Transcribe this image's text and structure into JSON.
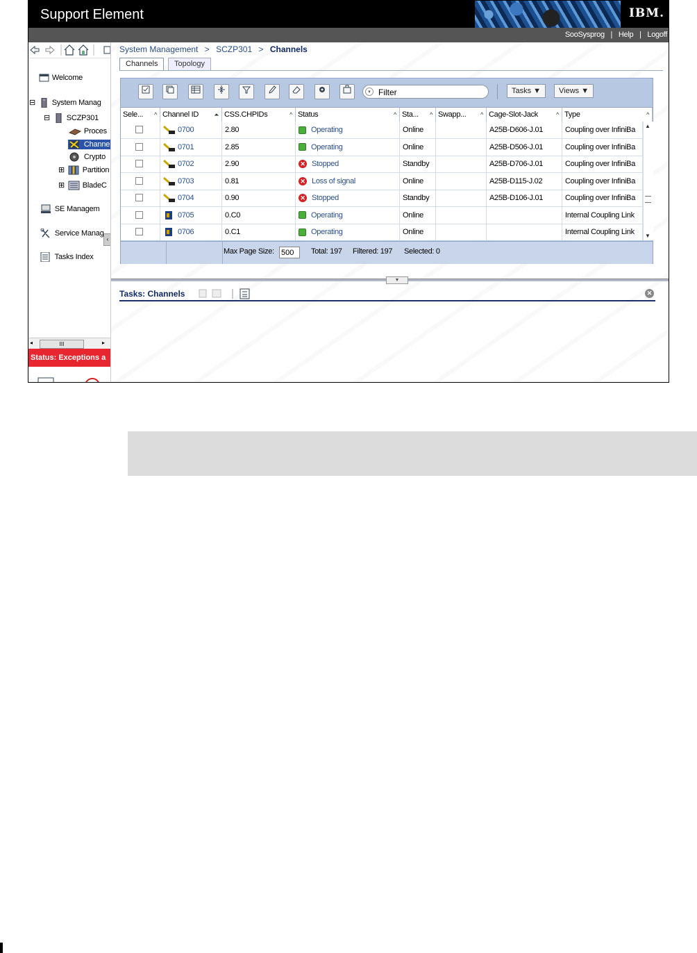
{
  "app": {
    "title": "Support Element",
    "logo": "IBM."
  },
  "userbar": {
    "user": "SooSysprog",
    "help": "Help",
    "logoff": "Logoff",
    "sep": "|"
  },
  "nav": {
    "icons": [
      "back-arrow-icon",
      "forward-arrow-icon",
      "home-icon",
      "home-alt-icon",
      "tree-icon"
    ],
    "items": [
      {
        "label": "Welcome",
        "icon": "welcome-icon"
      },
      {
        "label": "System Manag",
        "icon": "system-icon"
      },
      {
        "label": "SCZP301",
        "icon": "cpc-icon"
      },
      {
        "label": "Proces",
        "icon": "processor-icon"
      },
      {
        "label": "Channe",
        "icon": "channel-icon"
      },
      {
        "label": "Crypto",
        "icon": "crypto-icon"
      },
      {
        "label": "Partition",
        "icon": "partition-icon"
      },
      {
        "label": "BladeC",
        "icon": "blade-icon"
      },
      {
        "label": "SE Managem",
        "icon": "se-management-icon"
      },
      {
        "label": "Service Manag",
        "icon": "service-icon"
      },
      {
        "label": "Tasks Index",
        "icon": "tasks-index-icon"
      }
    ],
    "expand_minus": "⊟",
    "expand_plus": "⊞",
    "scroll_thumb": "III",
    "status": "Status: Exceptions a"
  },
  "breadcrumb": {
    "item1": "System Management",
    "item2": "SCZP301",
    "current": "Channels",
    "sep": ">"
  },
  "tabs": {
    "channels": "Channels",
    "topology": "Topology"
  },
  "toolbar": {
    "filter_placeholder": "Filter",
    "filter_value": "Filter",
    "tasks": "Tasks ▼",
    "views": "Views ▼"
  },
  "table": {
    "columns": [
      "Sele...",
      "Channel ID",
      "CSS.CHPIDs",
      "Status",
      "Sta...",
      "Swapp...",
      "Cage-Slot-Jack",
      "Type"
    ],
    "rows": [
      {
        "id": "0700",
        "chpid": "2.80",
        "status": "Operating",
        "ok": true,
        "state": "Online",
        "swap": "",
        "jack": "A25B-D606-J.01",
        "type": "Coupling over InfiniBa",
        "kind": "coupling"
      },
      {
        "id": "0701",
        "chpid": "2.85",
        "status": "Operating",
        "ok": true,
        "state": "Online",
        "swap": "",
        "jack": "A25B-D506-J.01",
        "type": "Coupling over InfiniBa",
        "kind": "coupling"
      },
      {
        "id": "0702",
        "chpid": "2.90",
        "status": "Stopped",
        "ok": false,
        "state": "Standby",
        "swap": "",
        "jack": "A25B-D706-J.01",
        "type": "Coupling over InfiniBa",
        "kind": "coupling"
      },
      {
        "id": "0703",
        "chpid": "0.81",
        "status": "Loss of signal",
        "ok": false,
        "state": "Online",
        "swap": "",
        "jack": "A25B-D115-J.02",
        "type": "Coupling over InfiniBa",
        "kind": "coupling"
      },
      {
        "id": "0704",
        "chpid": "0.90",
        "status": "Stopped",
        "ok": false,
        "state": "Standby",
        "swap": "",
        "jack": "A25B-D106-J.01",
        "type": "Coupling over InfiniBa",
        "kind": "coupling"
      },
      {
        "id": "0705",
        "chpid": "0.C0",
        "status": "Operating",
        "ok": true,
        "state": "Online",
        "swap": "",
        "jack": "",
        "type": "Internal Coupling Link",
        "kind": "internal"
      },
      {
        "id": "0706",
        "chpid": "0.C1",
        "status": "Operating",
        "ok": true,
        "state": "Online",
        "swap": "",
        "jack": "",
        "type": "Internal Coupling Link",
        "kind": "internal"
      }
    ],
    "footer": {
      "max_page_label": "Max Page Size:",
      "max_page_value": "500",
      "total": "Total: 197",
      "filtered": "Filtered: 197",
      "selected": "Selected: 0"
    }
  },
  "tasks_pane": {
    "title": "Tasks: Channels"
  },
  "colors": {
    "status_ok": "#4caf3c",
    "status_bad": "#d42121",
    "header_bg": "#000000",
    "status_bar": "#e8262f",
    "panel_bg": "#b7c8e2"
  }
}
